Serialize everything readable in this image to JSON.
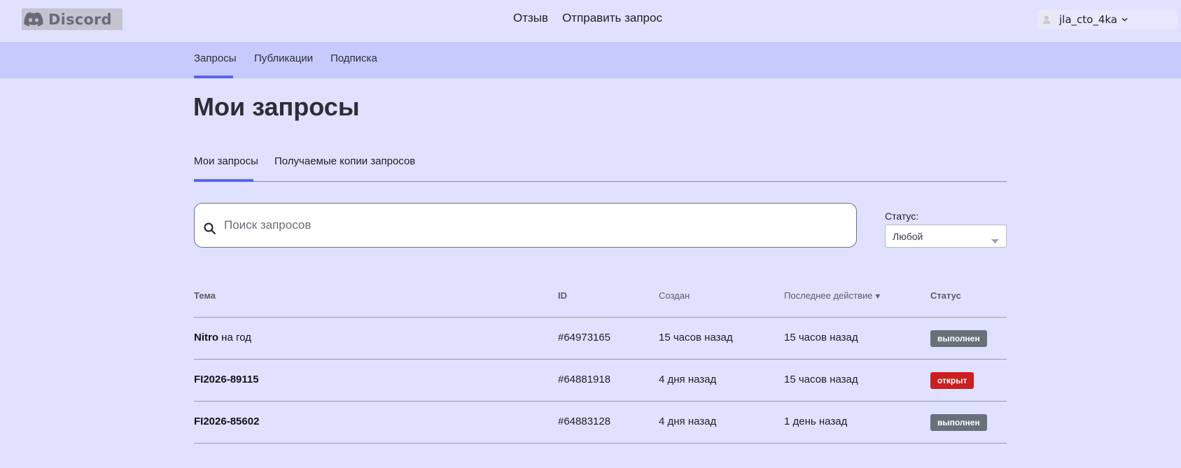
{
  "header": {
    "logo_text": "Discord",
    "links": [
      "Отзыв",
      "Отправить запрос"
    ],
    "user_name": "jla_cto_4ka"
  },
  "subnav": {
    "items": [
      "Запросы",
      "Публикации",
      "Подписка"
    ],
    "active": "Запросы"
  },
  "page": {
    "title": "Мои запросы"
  },
  "tabs": {
    "items": [
      "Мои запросы",
      "Получаемые копии запросов"
    ],
    "active": "Мои запросы"
  },
  "search": {
    "placeholder": "Поиск запросов",
    "value": ""
  },
  "filter": {
    "label": "Статус:",
    "value": "Любой"
  },
  "table": {
    "columns": [
      "Тема",
      "ID",
      "Создан",
      "Последнее действие",
      "Статус"
    ],
    "sorted_column": "Последнее действие",
    "sort_indicator": "▼",
    "rows": [
      {
        "subject_bold": "Nitro",
        "subject_rest": " на год",
        "id": "#64973165",
        "created": "15 часов назад",
        "last_action": "15 часов назад",
        "status": "выполнен"
      },
      {
        "subject_bold": "FI2026-89115",
        "subject_rest": "",
        "id": "#64881918",
        "created": "4 дня назад",
        "last_action": "15 часов назад",
        "status": "открыт"
      },
      {
        "subject_bold": "FI2026-85602",
        "subject_rest": "",
        "id": "#64883128",
        "created": "4 дня назад",
        "last_action": "1 день назад",
        "status": "выполнен"
      }
    ]
  },
  "colors": {
    "page_bg": "#dfe1fe",
    "subnav_bg": "#c7cafc",
    "accent": "#5865f2",
    "badge_done": "#68717a",
    "badge_open": "#cc1f1f"
  }
}
